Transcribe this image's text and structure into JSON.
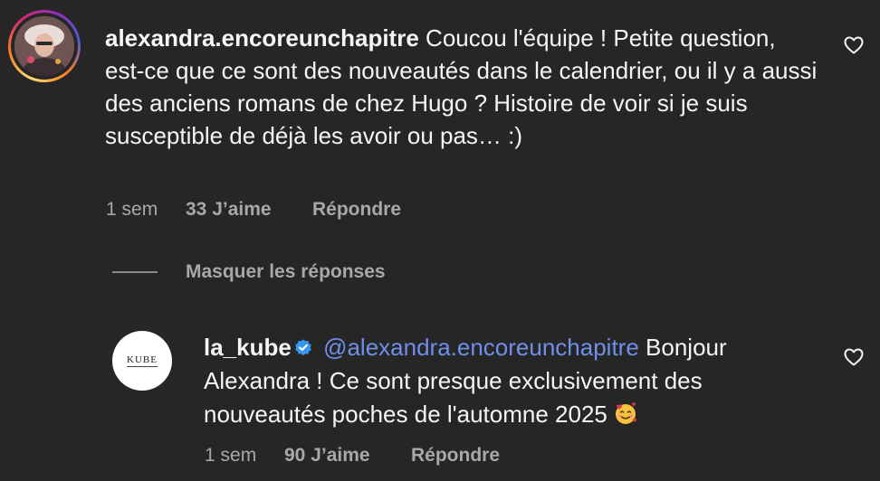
{
  "comment": {
    "username": "alexandra.encoreunchapitre",
    "text": "Coucou l'équipe ! Petite question, est-ce que ce sont des nouveautés dans le calendrier, ou il y a aussi des anciens romans de chez Hugo ? Histoire de voir si je suis susceptible de déjà les avoir ou pas… :)",
    "time": "1 sem",
    "likes": "33 J’aime",
    "reply_label": "Répondre"
  },
  "thread": {
    "hide_replies_label": "Masquer les réponses"
  },
  "reply": {
    "username": "la_kube",
    "avatar_logo": "KUBE",
    "mention": "@alexandra.encoreunchapitre",
    "text": "Bonjour Alexandra ! Ce sont presque exclusivement des nouveautés poches de l'automne 2025",
    "time": "1 sem",
    "likes": "90 J’aime",
    "reply_label": "Répondre",
    "emoji_icon": "smiling-face-with-hearts-icon"
  },
  "icons": {
    "like": "heart-outline-icon",
    "verified": "verified-badge-icon"
  },
  "colors": {
    "background": "#262626",
    "text_primary": "#f5f5f5",
    "text_secondary": "#a8a8a8",
    "mention": "#6f8fe8",
    "verified": "#3897f0"
  }
}
